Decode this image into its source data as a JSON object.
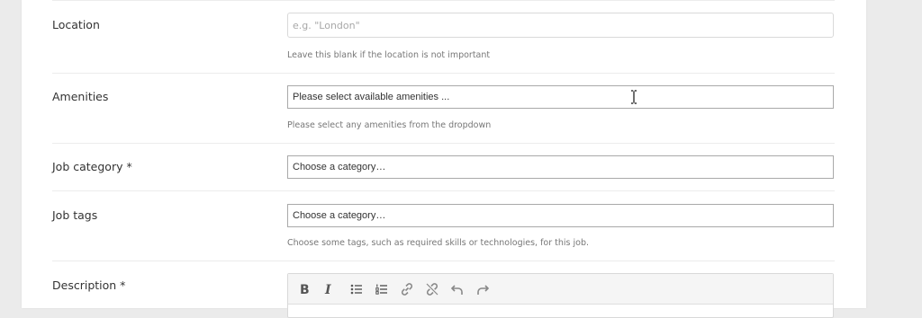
{
  "form": {
    "location": {
      "label": "Location",
      "placeholder": "e.g. \"London\"",
      "hint": "Leave this blank if the location is not important"
    },
    "amenities": {
      "label": "Amenities",
      "placeholder": "Please select available amenities ...",
      "hint": "Please select any amenities from the dropdown"
    },
    "job_category": {
      "label": "Job category *",
      "placeholder": "Choose a category…"
    },
    "job_tags": {
      "label": "Job tags",
      "placeholder": "Choose a category…",
      "hint": "Choose some tags, such as required skills or technologies, for this job."
    },
    "description": {
      "label": "Description *",
      "toolbar_icons": [
        "bold-icon",
        "italic-icon",
        "bullet-list-icon",
        "numbered-list-icon",
        "link-icon",
        "unlink-icon",
        "undo-icon",
        "redo-icon"
      ]
    }
  }
}
